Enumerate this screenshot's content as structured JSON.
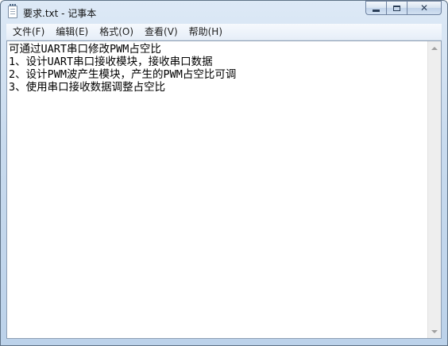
{
  "window": {
    "title": "要求.txt - 记事本",
    "controls": {
      "minimize": "minimize",
      "maximize": "maximize",
      "close": "close"
    }
  },
  "menu": {
    "items": [
      {
        "label": "文件(F)"
      },
      {
        "label": "编辑(E)"
      },
      {
        "label": "格式(O)"
      },
      {
        "label": "查看(V)"
      },
      {
        "label": "帮助(H)"
      }
    ]
  },
  "document": {
    "text": "可通过UART串口修改PWM占空比\n1、设计UART串口接收模块，接收串口数据\n2、设计PWM波产生模块，产生的PWM占空比可调\n3、使用串口接收数据调整占空比"
  },
  "icons": {
    "app": "notepad-icon",
    "scroll_up": "scroll-up-arrow-icon",
    "scroll_down": "scroll-down-arrow-icon"
  }
}
